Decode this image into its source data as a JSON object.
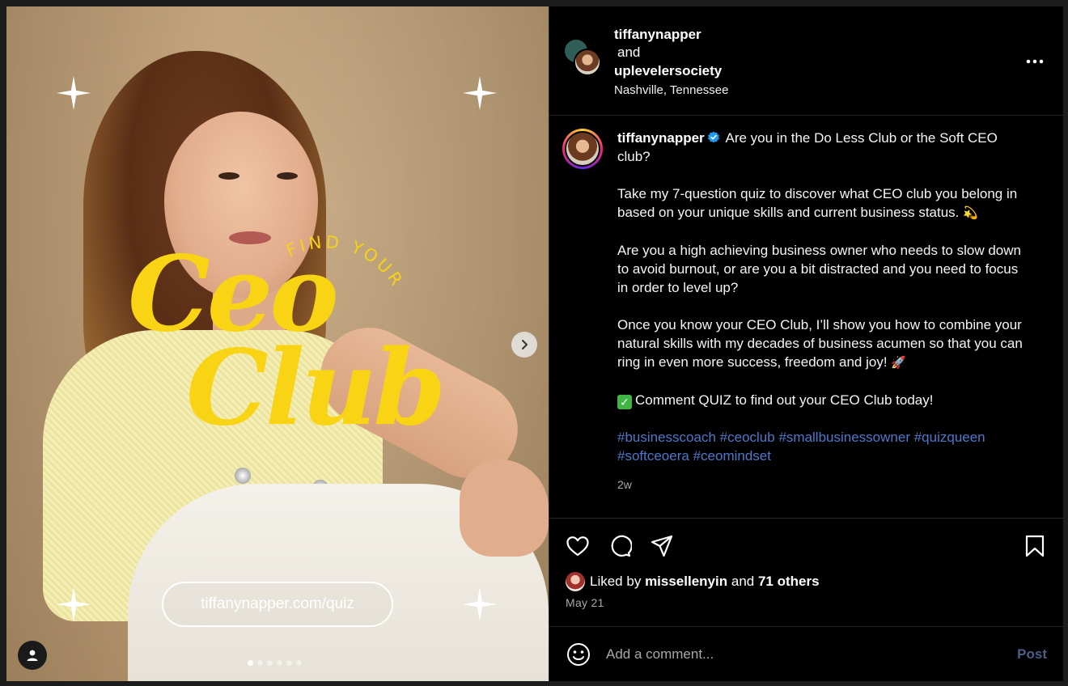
{
  "media": {
    "find_your_text": "FIND YOUR",
    "title_line1": "Ceo",
    "title_line2": "Club",
    "url_pill": "tiffanynapper.com/quiz",
    "slide_count": 6,
    "active_slide": 1,
    "accent_color": "#f8d414"
  },
  "header": {
    "user1": "tiffanynapper",
    "joiner": "and",
    "user2": "uplevelersociety",
    "location": "Nashville, Tennessee",
    "more_icon": "more-horizontal-icon"
  },
  "caption": {
    "username": "tiffanynapper",
    "verified_icon": "verified-badge-icon",
    "p1": "Are you in the Do Less Club or the Soft CEO club?",
    "p2": "Take my 7-question quiz to discover what CEO club you belong in based on your unique skills and current business status.",
    "p2_emoji": "💫",
    "p3": "Are you a high achieving business owner who needs to slow down to avoid burnout, or are you a bit distracted and you need to focus in order to level up?",
    "p4": "Once you know your CEO Club, I’ll show you how to combine your natural skills with my decades of business acumen so that you can ring in even more success, freedom and joy!",
    "p4_emoji": "🚀",
    "p5_emoji": "✓",
    "p5": "Comment QUIZ to find out your CEO Club today!",
    "hashtags": [
      "#businesscoach",
      "#ceoclub",
      "#smallbusinessowner",
      "#quizqueen",
      "#softceoera",
      "#ceomindset"
    ],
    "time_ago": "2w"
  },
  "actions": {
    "like_icon": "heart-icon",
    "comment_icon": "comment-icon",
    "share_icon": "share-icon",
    "save_icon": "bookmark-icon",
    "liked_by_prefix": "Liked by",
    "liked_by_user": "missellenyin",
    "liked_by_and": "and",
    "liked_by_others": "71 others",
    "date": "May 21"
  },
  "comment": {
    "placeholder": "Add a comment...",
    "post_label": "Post",
    "emoji_icon": "emoji-icon"
  },
  "colors": {
    "hashtag": "#4f78c9",
    "post_button_disabled": "#4b5f88",
    "verified": "#1d9bf0"
  }
}
